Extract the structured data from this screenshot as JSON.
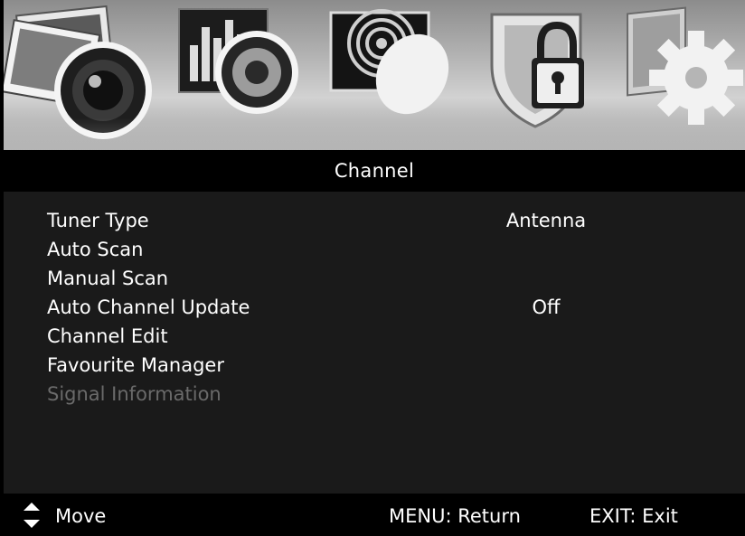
{
  "top_icons": [
    {
      "name": "picture-icon"
    },
    {
      "name": "sound-icon"
    },
    {
      "name": "channel-icon"
    },
    {
      "name": "lock-icon"
    },
    {
      "name": "setup-icon"
    }
  ],
  "title": "Channel",
  "menu": {
    "items": [
      {
        "label": "Tuner Type",
        "value": "Antenna",
        "enabled": true
      },
      {
        "label": "Auto Scan",
        "value": "",
        "enabled": true
      },
      {
        "label": "Manual Scan",
        "value": "",
        "enabled": true
      },
      {
        "label": "Auto Channel Update",
        "value": "Off",
        "enabled": true
      },
      {
        "label": "Channel Edit",
        "value": "",
        "enabled": true
      },
      {
        "label": "Favourite Manager",
        "value": "",
        "enabled": true
      },
      {
        "label": "Signal Information",
        "value": "",
        "enabled": false
      }
    ]
  },
  "footer": {
    "move_label": "Move",
    "menu_hint": "MENU: Return",
    "exit_hint": "EXIT: Exit"
  },
  "colors": {
    "panel_background": "#1a1a1a",
    "disabled_text": "#6a6a6a",
    "text": "#ffffff"
  }
}
